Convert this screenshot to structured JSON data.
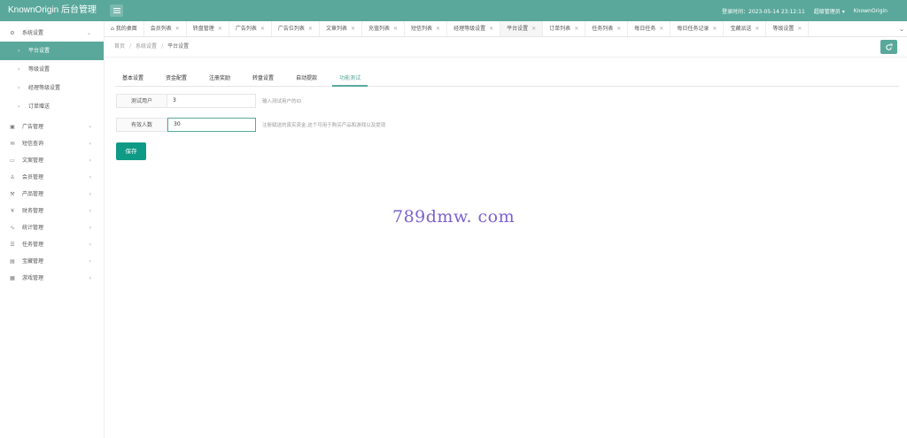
{
  "header": {
    "title": "KnownOrigin 后台管理",
    "login_time": "登录时间：2023-05-14 23:12:11",
    "user_menu": "超级管理员",
    "brand": "KnownOrigin"
  },
  "sidebar": {
    "group": {
      "label": "系统设置",
      "icon": "gear-icon"
    },
    "subitems": [
      "平台设置",
      "等级设置",
      "经理等级设置",
      "订单赠送"
    ],
    "items": [
      {
        "label": "广告管理",
        "icon": "image-icon"
      },
      {
        "label": "短信查询",
        "icon": "mail-icon"
      },
      {
        "label": "文案管理",
        "icon": "book-icon"
      },
      {
        "label": "会员管理",
        "icon": "user-icon"
      },
      {
        "label": "产品管理",
        "icon": "box-icon"
      },
      {
        "label": "财务管理",
        "icon": "yen-icon"
      },
      {
        "label": "统计管理",
        "icon": "pulse-icon"
      },
      {
        "label": "任务管理",
        "icon": "sliders-icon"
      },
      {
        "label": "宝藏管理",
        "icon": "chest-icon"
      },
      {
        "label": "游戏管理",
        "icon": "game-icon"
      }
    ]
  },
  "tabs": [
    "我的桌面",
    "会员列表",
    "转盘管理",
    "广告列表",
    "广告位列表",
    "文章列表",
    "充值列表",
    "短信列表",
    "经理等级设置",
    "平台设置",
    "订单列表",
    "任务列表",
    "每日任务",
    "每日任务记录",
    "宝藏派送",
    "等级设置"
  ],
  "breadcrumb": [
    "首页",
    "系统设置",
    "平台设置"
  ],
  "subtabs": [
    "基本设置",
    "资金配置",
    "注册奖励",
    "转盘设置",
    "自动提款",
    "功能测试"
  ],
  "form": {
    "test_user": {
      "label": "测试用户",
      "value": "3",
      "hint": "输入测试用户的ID"
    },
    "valid_count": {
      "label": "有效人数",
      "value": "30",
      "hint": "注册赋送的真实资金,这个可用于购买产品和游戏以及提现"
    },
    "save_label": "保存"
  },
  "watermark": "789dmw. com",
  "colors": {
    "accent": "#5aa89b",
    "button": "#0f9a85"
  }
}
